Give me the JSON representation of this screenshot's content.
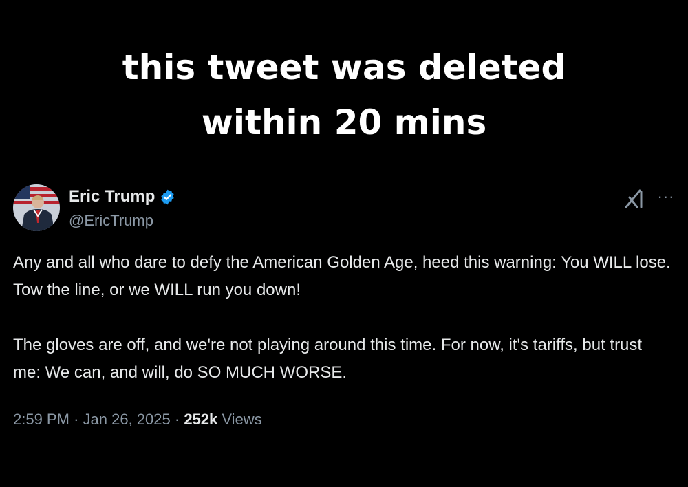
{
  "caption": {
    "line1": "this tweet was deleted",
    "line2": "within 20 mins"
  },
  "tweet": {
    "author_name": "Eric Trump",
    "handle": "@EricTrump",
    "paragraphs": [
      "Any and all who dare to defy the American Golden Age, heed this warning: You WILL lose. Tow the line, or we WILL run you down!",
      "The gloves are off, and we're not playing around this time. For now, it's tariffs, but trust me: We can, and will, do SO MUCH WORSE."
    ],
    "time": "2:59 PM",
    "date": "Jan 26, 2025",
    "separator": "·",
    "views_count": "252k",
    "views_label": "Views",
    "more_glyph": "···"
  },
  "icons": {
    "verified": "verified-badge-icon",
    "grok": "grok-icon",
    "more": "more-options-icon"
  },
  "colors": {
    "background": "#000000",
    "text_primary": "#e7e9ea",
    "text_secondary": "#8b98a5",
    "verified_blue": "#1d9bf0"
  }
}
